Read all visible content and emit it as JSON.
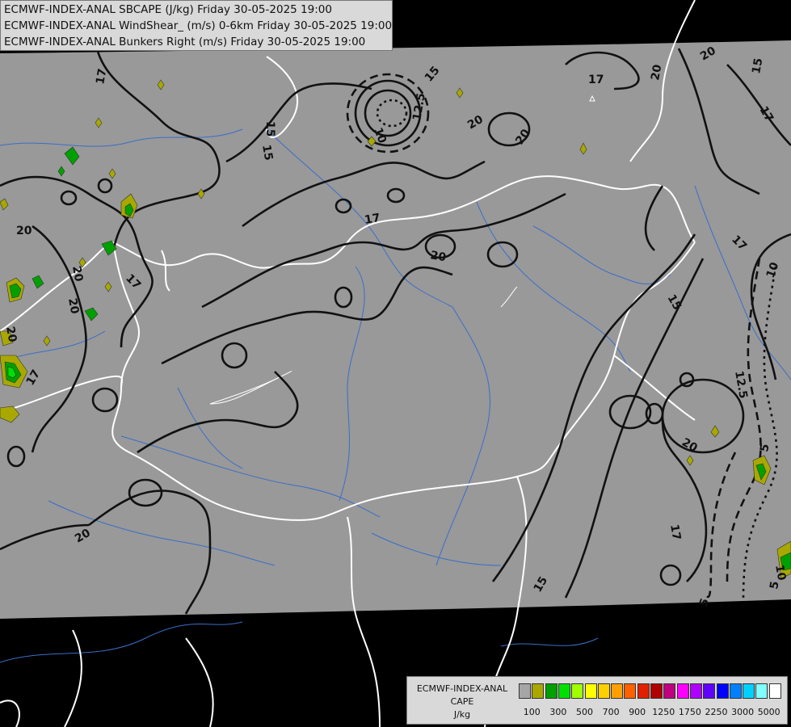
{
  "title_lines": [
    "ECMWF-INDEX-ANAL SBCAPE (J/kg) Friday 30-05-2025 19:00",
    "ECMWF-INDEX-ANAL WindShear_ (m/s) 0-6km Friday 30-05-2025 19:00",
    "ECMWF-INDEX-ANAL Bunkers Right (m/s) Friday 30-05-2025 19:00"
  ],
  "colors": {
    "background_out": "#000000",
    "data_area": "#999999",
    "contour": "#111111",
    "borders": "#ffffff",
    "rivers": "#3a6ec8"
  },
  "contour_labels": [
    "17",
    "15",
    "20",
    "12.5",
    "10",
    "15",
    "20",
    "20",
    "17",
    "20",
    "17",
    "20",
    "17",
    "20",
    "20",
    "20",
    "15",
    "15",
    "17",
    "17",
    "20",
    "10",
    "17",
    "15",
    "12.5",
    "20",
    "5",
    "17",
    "5",
    "5",
    "10",
    "15",
    "20"
  ],
  "legend": {
    "title_lines": [
      "ECMWF-INDEX-ANAL",
      "CAPE",
      "J/kg"
    ],
    "colors": [
      "#a6a6a6",
      "#a8a800",
      "#00a000",
      "#00e000",
      "#a0ff00",
      "#ffff00",
      "#ffd000",
      "#ffa000",
      "#ff6000",
      "#e02000",
      "#b00000",
      "#c00080",
      "#ff00ff",
      "#b000ff",
      "#6000ff",
      "#0000ff",
      "#0080ff",
      "#00d0ff",
      "#80ffff",
      "#ffffff"
    ],
    "tick_labels": [
      "100",
      "300",
      "500",
      "700",
      "900",
      "1250",
      "1750",
      "2250",
      "3000",
      "5000"
    ]
  }
}
